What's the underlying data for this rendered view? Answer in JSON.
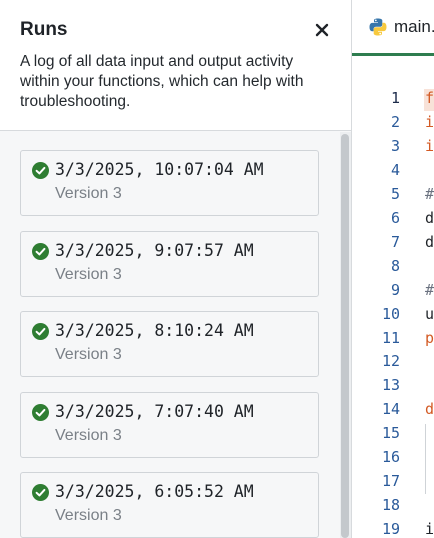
{
  "runs_panel": {
    "title": "Runs",
    "description": "A log of all data input and output activity within your functions, which can help with troubleshooting.",
    "runs": [
      {
        "timestamp": "3/3/2025, 10:07:04 AM",
        "version": "Version 3",
        "status": "success"
      },
      {
        "timestamp": "3/3/2025, 9:07:57 AM",
        "version": "Version 3",
        "status": "success"
      },
      {
        "timestamp": "3/3/2025, 8:10:24 AM",
        "version": "Version 3",
        "status": "success"
      },
      {
        "timestamp": "3/3/2025, 7:07:40 AM",
        "version": "Version 3",
        "status": "success"
      },
      {
        "timestamp": "3/3/2025, 6:05:52 AM",
        "version": "Version 3",
        "status": "success"
      }
    ]
  },
  "editor": {
    "tab_label": "main.",
    "line_numbers": [
      "1",
      "2",
      "3",
      "4",
      "5",
      "6",
      "7",
      "8",
      "9",
      "10",
      "11",
      "12",
      "13",
      "14",
      "15",
      "16",
      "17",
      "18",
      "19"
    ],
    "code_first_chars": [
      {
        "line": "1",
        "text": "f",
        "kind": "kw"
      },
      {
        "line": "2",
        "text": "i",
        "kind": "kw"
      },
      {
        "line": "3",
        "text": "i",
        "kind": "kw"
      },
      {
        "line": "5",
        "text": "#",
        "kind": "cm"
      },
      {
        "line": "6",
        "text": "d",
        "kind": "plain"
      },
      {
        "line": "7",
        "text": "d",
        "kind": "plain"
      },
      {
        "line": "9",
        "text": "#",
        "kind": "cm"
      },
      {
        "line": "10",
        "text": "u",
        "kind": "plain"
      },
      {
        "line": "11",
        "text": "p",
        "kind": "kw"
      },
      {
        "line": "14",
        "text": "d",
        "kind": "kw"
      },
      {
        "line": "19",
        "text": "i",
        "kind": "plain"
      }
    ]
  },
  "colors": {
    "success": "#2e7d32",
    "tab_underline": "#2e7d4f",
    "keyword": "#d35a24"
  },
  "icons": {
    "close": "close-icon",
    "status": "check-circle-icon",
    "file": "python-icon"
  }
}
